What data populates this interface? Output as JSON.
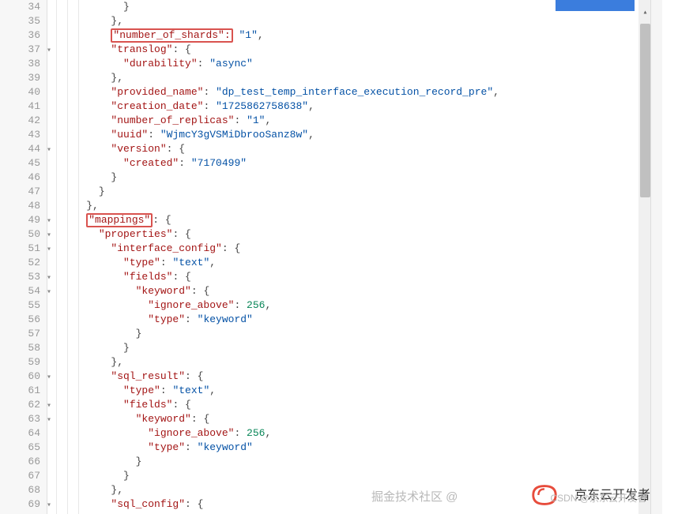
{
  "lines": [
    {
      "n": 34,
      "fold": "",
      "indent": 5,
      "tokens": [
        {
          "t": "punct",
          "v": "}"
        }
      ]
    },
    {
      "n": 35,
      "fold": "",
      "indent": 4,
      "tokens": [
        {
          "t": "punct",
          "v": "},"
        }
      ]
    },
    {
      "n": 36,
      "fold": "",
      "indent": 4,
      "tokens": [
        {
          "t": "hlkey",
          "v": "\"number_of_shards\":"
        },
        {
          "t": "punct",
          "v": " "
        },
        {
          "t": "string",
          "v": "\"1\""
        },
        {
          "t": "punct",
          "v": ","
        }
      ]
    },
    {
      "n": 37,
      "fold": "▾",
      "indent": 4,
      "tokens": [
        {
          "t": "key",
          "v": "\"translog\""
        },
        {
          "t": "punct",
          "v": ": {"
        }
      ]
    },
    {
      "n": 38,
      "fold": "",
      "indent": 5,
      "tokens": [
        {
          "t": "key",
          "v": "\"durability\""
        },
        {
          "t": "punct",
          "v": ": "
        },
        {
          "t": "string",
          "v": "\"async\""
        }
      ]
    },
    {
      "n": 39,
      "fold": "",
      "indent": 4,
      "tokens": [
        {
          "t": "punct",
          "v": "},"
        }
      ]
    },
    {
      "n": 40,
      "fold": "",
      "indent": 4,
      "tokens": [
        {
          "t": "key",
          "v": "\"provided_name\""
        },
        {
          "t": "punct",
          "v": ": "
        },
        {
          "t": "string",
          "v": "\"dp_test_temp_interface_execution_record_pre\""
        },
        {
          "t": "punct",
          "v": ","
        }
      ]
    },
    {
      "n": 41,
      "fold": "",
      "indent": 4,
      "tokens": [
        {
          "t": "key",
          "v": "\"creation_date\""
        },
        {
          "t": "punct",
          "v": ": "
        },
        {
          "t": "string",
          "v": "\"1725862758638\""
        },
        {
          "t": "punct",
          "v": ","
        }
      ]
    },
    {
      "n": 42,
      "fold": "",
      "indent": 4,
      "tokens": [
        {
          "t": "key",
          "v": "\"number_of_replicas\""
        },
        {
          "t": "punct",
          "v": ": "
        },
        {
          "t": "string",
          "v": "\"1\""
        },
        {
          "t": "punct",
          "v": ","
        }
      ]
    },
    {
      "n": 43,
      "fold": "",
      "indent": 4,
      "tokens": [
        {
          "t": "key",
          "v": "\"uuid\""
        },
        {
          "t": "punct",
          "v": ": "
        },
        {
          "t": "string",
          "v": "\"WjmcY3gVSMiDbrooSanz8w\""
        },
        {
          "t": "punct",
          "v": ","
        }
      ]
    },
    {
      "n": 44,
      "fold": "▾",
      "indent": 4,
      "tokens": [
        {
          "t": "key",
          "v": "\"version\""
        },
        {
          "t": "punct",
          "v": ": {"
        }
      ]
    },
    {
      "n": 45,
      "fold": "",
      "indent": 5,
      "tokens": [
        {
          "t": "key",
          "v": "\"created\""
        },
        {
          "t": "punct",
          "v": ": "
        },
        {
          "t": "string",
          "v": "\"7170499\""
        }
      ]
    },
    {
      "n": 46,
      "fold": "",
      "indent": 4,
      "tokens": [
        {
          "t": "punct",
          "v": "}"
        }
      ]
    },
    {
      "n": 47,
      "fold": "",
      "indent": 3,
      "tokens": [
        {
          "t": "punct",
          "v": "}"
        }
      ]
    },
    {
      "n": 48,
      "fold": "",
      "indent": 2,
      "tokens": [
        {
          "t": "punct",
          "v": "},"
        }
      ]
    },
    {
      "n": 49,
      "fold": "▾",
      "indent": 2,
      "tokens": [
        {
          "t": "hlkey",
          "v": "\"mappings\""
        },
        {
          "t": "punct",
          "v": ": {"
        }
      ]
    },
    {
      "n": 50,
      "fold": "▾",
      "indent": 3,
      "tokens": [
        {
          "t": "key",
          "v": "\"properties\""
        },
        {
          "t": "punct",
          "v": ": {"
        }
      ]
    },
    {
      "n": 51,
      "fold": "▾",
      "indent": 4,
      "tokens": [
        {
          "t": "key",
          "v": "\"interface_config\""
        },
        {
          "t": "punct",
          "v": ": {"
        }
      ]
    },
    {
      "n": 52,
      "fold": "",
      "indent": 5,
      "tokens": [
        {
          "t": "key",
          "v": "\"type\""
        },
        {
          "t": "punct",
          "v": ": "
        },
        {
          "t": "string",
          "v": "\"text\""
        },
        {
          "t": "punct",
          "v": ","
        }
      ]
    },
    {
      "n": 53,
      "fold": "▾",
      "indent": 5,
      "tokens": [
        {
          "t": "key",
          "v": "\"fields\""
        },
        {
          "t": "punct",
          "v": ": {"
        }
      ]
    },
    {
      "n": 54,
      "fold": "▾",
      "indent": 6,
      "tokens": [
        {
          "t": "key",
          "v": "\"keyword\""
        },
        {
          "t": "punct",
          "v": ": {"
        }
      ]
    },
    {
      "n": 55,
      "fold": "",
      "indent": 7,
      "tokens": [
        {
          "t": "key",
          "v": "\"ignore_above\""
        },
        {
          "t": "punct",
          "v": ": "
        },
        {
          "t": "number",
          "v": "256"
        },
        {
          "t": "punct",
          "v": ","
        }
      ]
    },
    {
      "n": 56,
      "fold": "",
      "indent": 7,
      "tokens": [
        {
          "t": "key",
          "v": "\"type\""
        },
        {
          "t": "punct",
          "v": ": "
        },
        {
          "t": "string",
          "v": "\"keyword\""
        }
      ]
    },
    {
      "n": 57,
      "fold": "",
      "indent": 6,
      "tokens": [
        {
          "t": "punct",
          "v": "}"
        }
      ]
    },
    {
      "n": 58,
      "fold": "",
      "indent": 5,
      "tokens": [
        {
          "t": "punct",
          "v": "}"
        }
      ]
    },
    {
      "n": 59,
      "fold": "",
      "indent": 4,
      "tokens": [
        {
          "t": "punct",
          "v": "},"
        }
      ]
    },
    {
      "n": 60,
      "fold": "▾",
      "indent": 4,
      "tokens": [
        {
          "t": "key",
          "v": "\"sql_result\""
        },
        {
          "t": "punct",
          "v": ": {"
        }
      ]
    },
    {
      "n": 61,
      "fold": "",
      "indent": 5,
      "tokens": [
        {
          "t": "key",
          "v": "\"type\""
        },
        {
          "t": "punct",
          "v": ": "
        },
        {
          "t": "string",
          "v": "\"text\""
        },
        {
          "t": "punct",
          "v": ","
        }
      ]
    },
    {
      "n": 62,
      "fold": "▾",
      "indent": 5,
      "tokens": [
        {
          "t": "key",
          "v": "\"fields\""
        },
        {
          "t": "punct",
          "v": ": {"
        }
      ]
    },
    {
      "n": 63,
      "fold": "▾",
      "indent": 6,
      "tokens": [
        {
          "t": "key",
          "v": "\"keyword\""
        },
        {
          "t": "punct",
          "v": ": {"
        }
      ]
    },
    {
      "n": 64,
      "fold": "",
      "indent": 7,
      "tokens": [
        {
          "t": "key",
          "v": "\"ignore_above\""
        },
        {
          "t": "punct",
          "v": ": "
        },
        {
          "t": "number",
          "v": "256"
        },
        {
          "t": "punct",
          "v": ","
        }
      ]
    },
    {
      "n": 65,
      "fold": "",
      "indent": 7,
      "tokens": [
        {
          "t": "key",
          "v": "\"type\""
        },
        {
          "t": "punct",
          "v": ": "
        },
        {
          "t": "string",
          "v": "\"keyword\""
        }
      ]
    },
    {
      "n": 66,
      "fold": "",
      "indent": 6,
      "tokens": [
        {
          "t": "punct",
          "v": "}"
        }
      ]
    },
    {
      "n": 67,
      "fold": "",
      "indent": 5,
      "tokens": [
        {
          "t": "punct",
          "v": "}"
        }
      ]
    },
    {
      "n": 68,
      "fold": "",
      "indent": 4,
      "tokens": [
        {
          "t": "punct",
          "v": "},"
        }
      ]
    },
    {
      "n": 69,
      "fold": "▾",
      "indent": 4,
      "tokens": [
        {
          "t": "key",
          "v": "\"sql_config\""
        },
        {
          "t": "punct",
          "v": ": {"
        }
      ]
    }
  ],
  "watermarks": {
    "juejin": "掘金技术社区 @",
    "csdn": "CSDN @京东云开发者",
    "logo_text": "京东云开发者"
  }
}
